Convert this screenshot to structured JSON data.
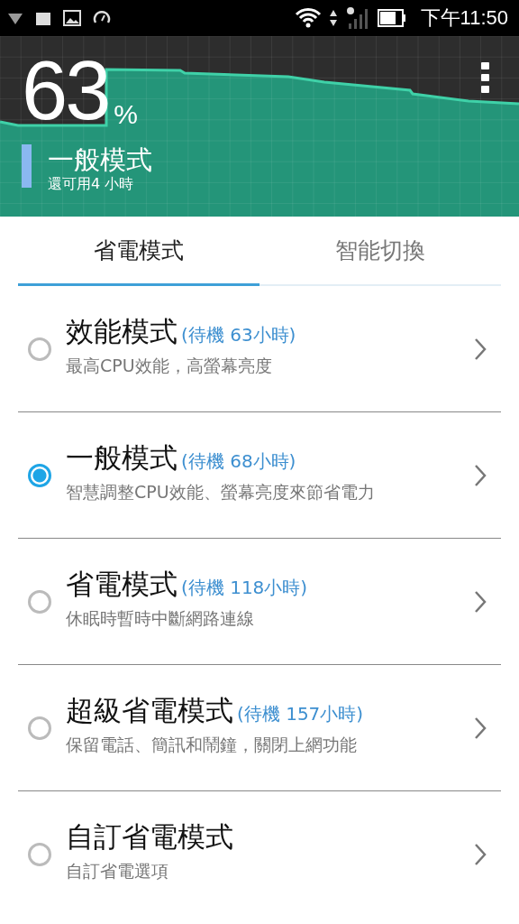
{
  "status_bar": {
    "time": "下午11:50"
  },
  "battery": {
    "percent": "63",
    "unit": "%",
    "mode": "一般模式",
    "remaining": "還可用4 小時"
  },
  "tabs": [
    {
      "label": "省電模式",
      "selected": true
    },
    {
      "label": "智能切換",
      "selected": false
    }
  ],
  "modes": [
    {
      "title": "效能模式",
      "standby": "(待機 63小時)",
      "description": "最高CPU效能，高螢幕亮度",
      "selected": false
    },
    {
      "title": "一般模式",
      "standby": "(待機 68小時)",
      "description": "智慧調整CPU效能、螢幕亮度來節省電力",
      "selected": true
    },
    {
      "title": "省電模式",
      "standby": "(待機 118小時)",
      "description": "休眠時暫時中斷網路連線",
      "selected": false
    },
    {
      "title": "超級省電模式",
      "standby": "(待機 157小時)",
      "description": "保留電話、簡訊和鬧鐘，關閉上網功能",
      "selected": false
    },
    {
      "title": "自訂省電模式",
      "description": "自訂省電選項",
      "selected": false
    }
  ]
}
